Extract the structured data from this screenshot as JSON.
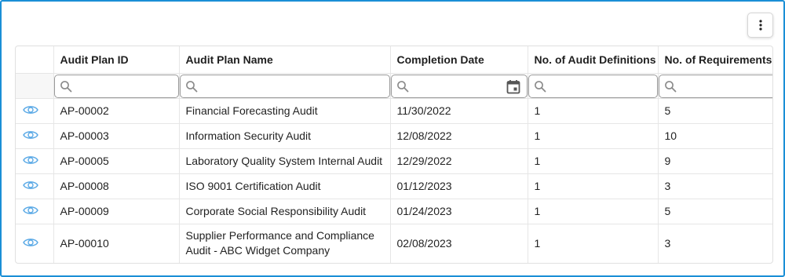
{
  "toolbar": {
    "menu_icon": "more-vertical-icon"
  },
  "colors": {
    "frame_border": "#1a8fd6",
    "eye_icon": "#5aa9e6"
  },
  "table": {
    "columns": [
      "Audit Plan ID",
      "Audit Plan Name",
      "Completion Date",
      "No. of Audit Definitions",
      "No. of Requirements"
    ],
    "filters": {
      "search_icon": "search-icon",
      "date_icon": "calendar-icon",
      "values": [
        "",
        "",
        "",
        "",
        ""
      ]
    },
    "rows": [
      {
        "id": "AP-00002",
        "name": "Financial Forecasting Audit",
        "completion_date": "11/30/2022",
        "audit_definitions": "1",
        "requirements": "5"
      },
      {
        "id": "AP-00003",
        "name": "Information Security Audit",
        "completion_date": "12/08/2022",
        "audit_definitions": "1",
        "requirements": "10"
      },
      {
        "id": "AP-00005",
        "name": "Laboratory Quality System Internal Audit",
        "completion_date": "12/29/2022",
        "audit_definitions": "1",
        "requirements": "9"
      },
      {
        "id": "AP-00008",
        "name": "ISO 9001 Certification Audit",
        "completion_date": "01/12/2023",
        "audit_definitions": "1",
        "requirements": "3"
      },
      {
        "id": "AP-00009",
        "name": "Corporate Social Responsibility Audit",
        "completion_date": "01/24/2023",
        "audit_definitions": "1",
        "requirements": "5"
      },
      {
        "id": "AP-00010",
        "name": "Supplier Performance and Compliance Audit - ABC Widget Company",
        "completion_date": "02/08/2023",
        "audit_definitions": "1",
        "requirements": "3"
      }
    ]
  }
}
